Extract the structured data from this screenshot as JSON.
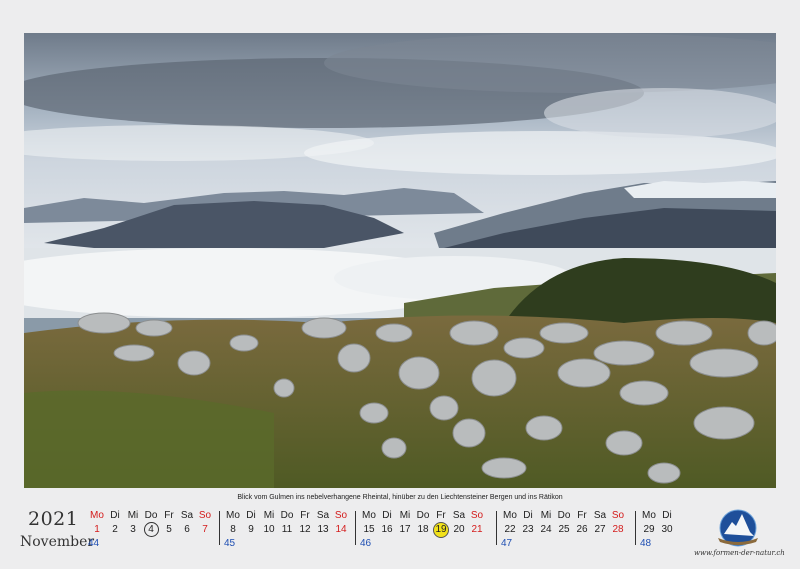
{
  "caption": "Blick vom Gulmen ins nebelverhangene Rheintal, hinüber zu den Liechtensteiner Bergen und ins Rätikon",
  "year": "2021",
  "month": "November",
  "website": "www.formen-der-natur.ch",
  "colors": {
    "sunday": "#d41c1c",
    "week_number": "#1f4fb3",
    "highlight": "#f2e21a"
  },
  "weeks": [
    {
      "number": "44",
      "days": [
        [
          "Mo",
          "1"
        ],
        [
          "Di",
          "2"
        ],
        [
          "Mi",
          "3"
        ],
        [
          "Do",
          "4"
        ],
        [
          "Fr",
          "5"
        ],
        [
          "Sa",
          "6"
        ],
        [
          "So",
          "7"
        ]
      ]
    },
    {
      "number": "45",
      "days": [
        [
          "Mo",
          "8"
        ],
        [
          "Di",
          "9"
        ],
        [
          "Mi",
          "10"
        ],
        [
          "Do",
          "11"
        ],
        [
          "Fr",
          "12"
        ],
        [
          "Sa",
          "13"
        ],
        [
          "So",
          "14"
        ]
      ]
    },
    {
      "number": "46",
      "days": [
        [
          "Mo",
          "15"
        ],
        [
          "Di",
          "16"
        ],
        [
          "Mi",
          "17"
        ],
        [
          "Do",
          "18"
        ],
        [
          "Fr",
          "19"
        ],
        [
          "Sa",
          "20"
        ],
        [
          "So",
          "21"
        ]
      ]
    },
    {
      "number": "47",
      "days": [
        [
          "Mo",
          "22"
        ],
        [
          "Di",
          "23"
        ],
        [
          "Mi",
          "24"
        ],
        [
          "Do",
          "25"
        ],
        [
          "Fr",
          "26"
        ],
        [
          "Sa",
          "27"
        ],
        [
          "So",
          "28"
        ]
      ]
    },
    {
      "number": "48",
      "days": [
        [
          "Mo",
          "29"
        ],
        [
          "Di",
          "30"
        ]
      ]
    }
  ],
  "circled_day": "4",
  "highlighted_day": "19",
  "red_days": [
    "1"
  ]
}
